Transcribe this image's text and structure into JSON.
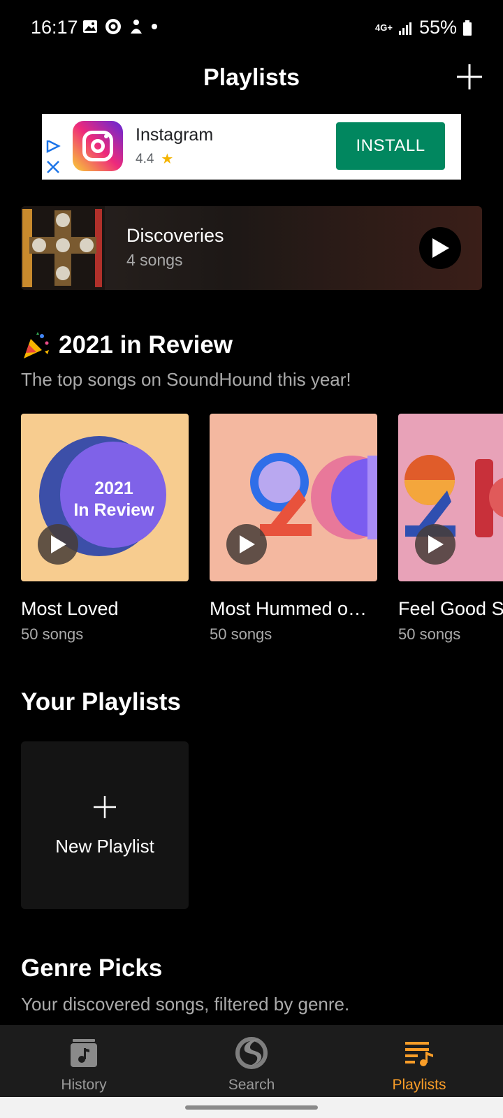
{
  "status_bar": {
    "time": "16:17",
    "network": "4G+",
    "battery": "55%"
  },
  "header": {
    "title": "Playlists",
    "add_icon": "plus-icon"
  },
  "ad": {
    "app_name": "Instagram",
    "rating": "4.4",
    "install_label": "INSTALL",
    "colors": {
      "install_bg": "#01875f"
    }
  },
  "discoveries": {
    "title": "Discoveries",
    "subtitle": "4 songs"
  },
  "review": {
    "title": "2021 in Review",
    "subtitle": "The top songs on SoundHound this year!",
    "cards": [
      {
        "title": "Most Loved",
        "subtitle": "50 songs",
        "art_text_line1": "2021",
        "art_text_line2": "In Review"
      },
      {
        "title": "Most Hummed o…",
        "subtitle": "50 songs"
      },
      {
        "title": "Feel Good S",
        "subtitle": "50 songs"
      }
    ]
  },
  "your_playlists": {
    "title": "Your Playlists",
    "new_label": "New Playlist"
  },
  "genre_picks": {
    "title": "Genre Picks",
    "subtitle": "Your discovered songs, filtered by genre."
  },
  "bottom_nav": {
    "items": [
      {
        "label": "History",
        "icon": "music-note-icon"
      },
      {
        "label": "Search",
        "icon": "soundhound-logo-icon"
      },
      {
        "label": "Playlists",
        "icon": "playlist-icon",
        "active": true
      }
    ],
    "active_color": "#f99d28"
  }
}
